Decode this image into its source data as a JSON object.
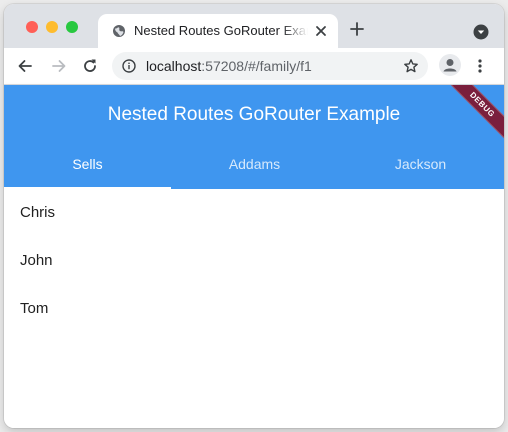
{
  "colors": {
    "appbar": "#3f96ef",
    "tab_active_text": "#ffffff",
    "tab_inactive_text": "#d6e9fc",
    "debug_banner": "#7a1f3d",
    "traffic_close": "#ff5f57",
    "traffic_minimize": "#febc2e",
    "traffic_maximize": "#28c840"
  },
  "browser": {
    "tab": {
      "title": "Nested Routes GoRouter Example",
      "icon": "globe-icon"
    },
    "address_bar": {
      "host": "localhost",
      "rest": ":57208/#/family/f1"
    },
    "icons": {
      "back": "arrow-left-icon",
      "forward": "arrow-right-icon",
      "reload": "reload-icon",
      "site_info": "info-icon",
      "bookmark": "star-icon",
      "profile": "person-icon",
      "menu": "kebab-icon",
      "new_tab": "plus-icon",
      "tab_search": "chevron-down-icon"
    }
  },
  "app": {
    "title": "Nested Routes GoRouter Example",
    "debug_label": "DEBUG",
    "tabs": [
      {
        "label": "Sells",
        "selected": true
      },
      {
        "label": "Addams",
        "selected": false
      },
      {
        "label": "Jackson",
        "selected": false
      }
    ],
    "people": [
      "Chris",
      "John",
      "Tom"
    ]
  }
}
